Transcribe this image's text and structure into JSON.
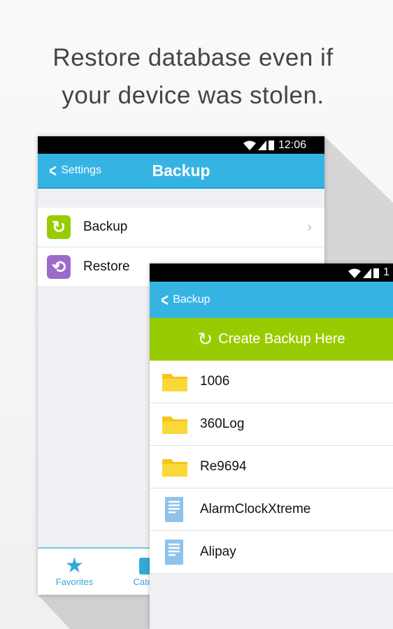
{
  "headline": [
    "Restore database even if",
    "your device was stolen."
  ],
  "colors": {
    "header": "#35b4e4",
    "backup_icon": "#99cc00",
    "restore_icon": "#9b6bc9",
    "create_bar": "#99cc00",
    "folder": "#f5c518",
    "file": "#8fc3ec"
  },
  "screen1": {
    "time": "12:06",
    "back_label": "Settings",
    "title": "Backup",
    "items": [
      {
        "label": "Backup",
        "icon": "refresh-icon"
      },
      {
        "label": "Restore",
        "icon": "sync-icon"
      }
    ],
    "nav": [
      {
        "label": "Favorites",
        "icon": "star-icon"
      },
      {
        "label": "Catego",
        "icon": "list-icon"
      }
    ]
  },
  "screen2": {
    "time": "1",
    "back_label": "Backup",
    "create_label": "Create Backup Here",
    "items": [
      {
        "label": "1006",
        "type": "folder"
      },
      {
        "label": "360Log",
        "type": "folder"
      },
      {
        "label": "Re9694",
        "type": "folder"
      },
      {
        "label": "AlarmClockXtreme",
        "type": "file"
      },
      {
        "label": "Alipay",
        "type": "file"
      }
    ]
  }
}
